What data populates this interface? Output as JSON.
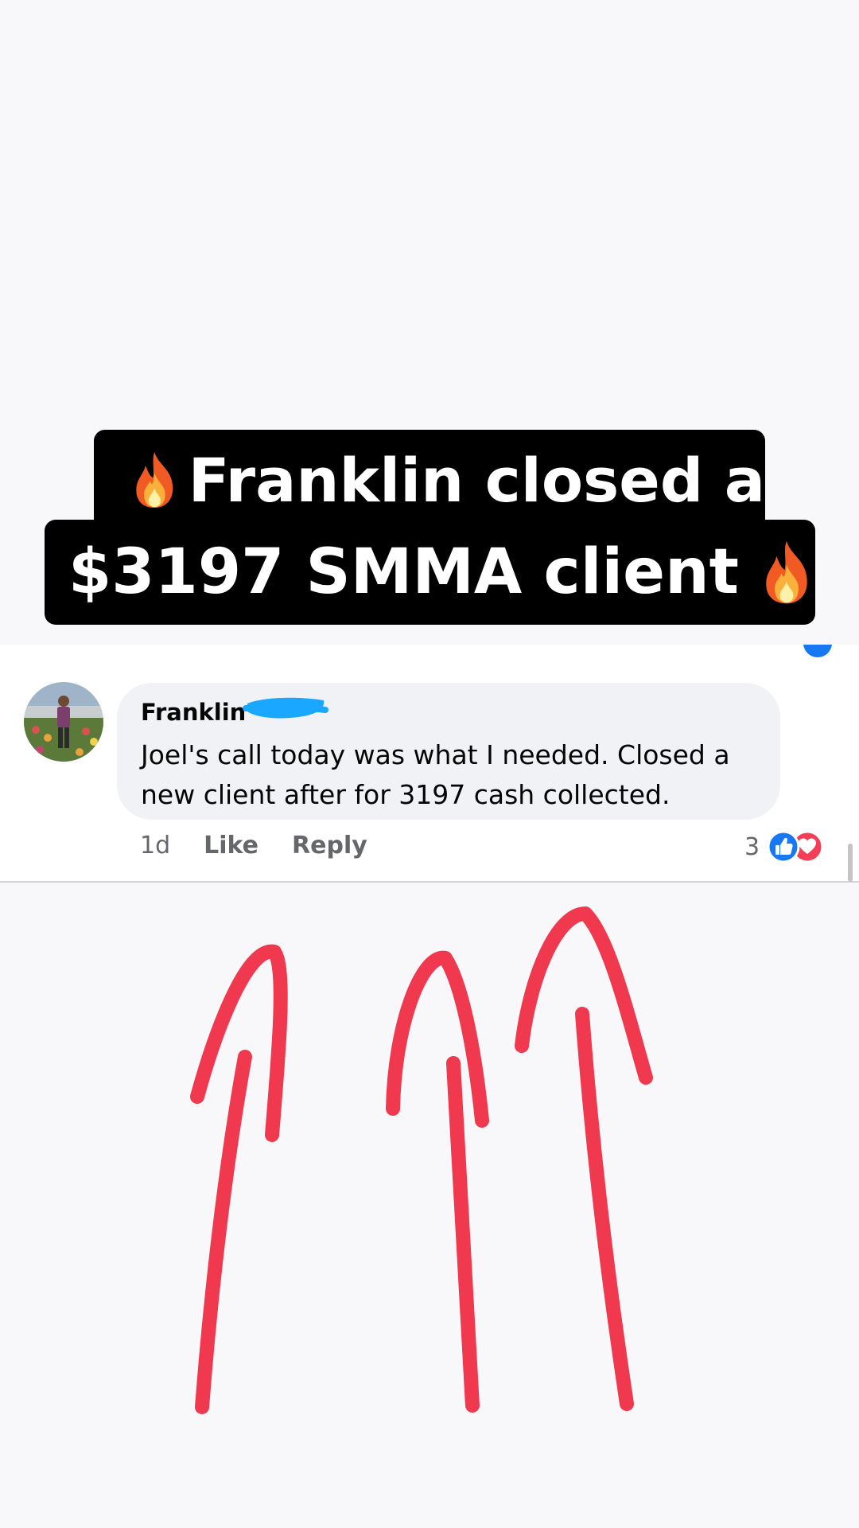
{
  "headline": {
    "line1": "Franklin closed a",
    "line2": "$3197 SMMA client"
  },
  "comment": {
    "author": "Franklin",
    "text": "Joel's call today was what I needed. Closed a new client after for 3197 cash collected.",
    "time": "1d",
    "like_label": "Like",
    "reply_label": "Reply",
    "reaction_count": "3",
    "reactions": [
      "like-icon",
      "love-icon"
    ]
  },
  "colors": {
    "overlay_bg": "#000000",
    "overlay_text": "#ffffff",
    "bubble_bg": "#f0f2f5",
    "like_blue": "#1877f2",
    "love_red": "#f33e58",
    "arrow_red": "#f0384f",
    "redaction_blue": "#1aa7ff"
  }
}
